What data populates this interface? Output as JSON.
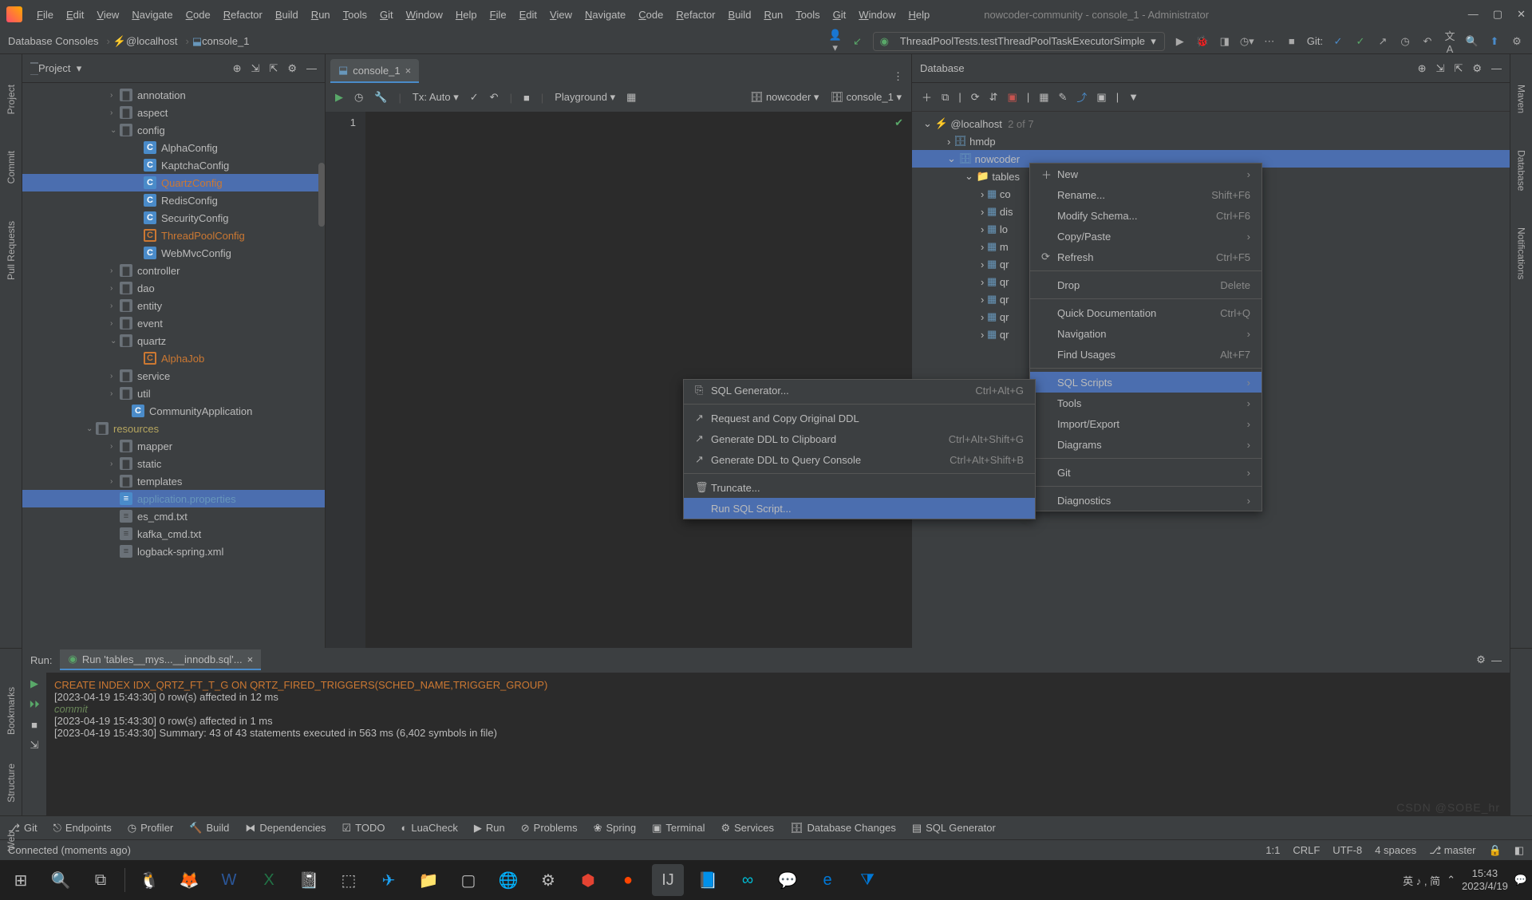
{
  "menubar": {
    "items": [
      "File",
      "Edit",
      "View",
      "Navigate",
      "Code",
      "Refactor",
      "Build",
      "Run",
      "Tools",
      "Git",
      "Window",
      "Help"
    ],
    "title": "nowcoder-community - console_1 - Administrator"
  },
  "breadcrumb": {
    "a": "Database Consoles",
    "b": "@localhost",
    "c": "console_1"
  },
  "runcfg": "ThreadPoolTests.testThreadPoolTaskExecutorSimple",
  "git_label": "Git:",
  "leftbar": [
    "Project",
    "Commit",
    "Pull Requests",
    "Bookmarks",
    "Structure",
    "Web"
  ],
  "rightbar": [
    "Maven",
    "Database",
    "Notifications"
  ],
  "project": {
    "title": "Project",
    "rows": [
      {
        "pad": 110,
        "chev": "›",
        "ic": "folder",
        "t": "annotation"
      },
      {
        "pad": 110,
        "chev": "›",
        "ic": "folder",
        "t": "aspect"
      },
      {
        "pad": 110,
        "chev": "⌄",
        "ic": "folder",
        "t": "config"
      },
      {
        "pad": 140,
        "chev": "",
        "ic": "class",
        "t": "AlphaConfig"
      },
      {
        "pad": 140,
        "chev": "",
        "ic": "class",
        "t": "KaptchaConfig"
      },
      {
        "pad": 140,
        "chev": "",
        "ic": "class",
        "t": "QuartzConfig",
        "cls": "orange",
        "sel": true
      },
      {
        "pad": 140,
        "chev": "",
        "ic": "class",
        "t": "RedisConfig"
      },
      {
        "pad": 140,
        "chev": "",
        "ic": "class",
        "t": "SecurityConfig"
      },
      {
        "pad": 140,
        "chev": "",
        "ic": "classO",
        "t": "ThreadPoolConfig",
        "cls": "orange"
      },
      {
        "pad": 140,
        "chev": "",
        "ic": "class",
        "t": "WebMvcConfig"
      },
      {
        "pad": 110,
        "chev": "›",
        "ic": "folder",
        "t": "controller"
      },
      {
        "pad": 110,
        "chev": "›",
        "ic": "folder",
        "t": "dao"
      },
      {
        "pad": 110,
        "chev": "›",
        "ic": "folder",
        "t": "entity"
      },
      {
        "pad": 110,
        "chev": "›",
        "ic": "folder",
        "t": "event"
      },
      {
        "pad": 110,
        "chev": "⌄",
        "ic": "folder",
        "t": "quartz"
      },
      {
        "pad": 140,
        "chev": "",
        "ic": "classO",
        "t": "AlphaJob",
        "cls": "orange"
      },
      {
        "pad": 110,
        "chev": "›",
        "ic": "folder",
        "t": "service"
      },
      {
        "pad": 110,
        "chev": "›",
        "ic": "folder",
        "t": "util"
      },
      {
        "pad": 125,
        "chev": "",
        "ic": "class",
        "t": "CommunityApplication"
      },
      {
        "pad": 80,
        "chev": "⌄",
        "ic": "resfolder",
        "t": "resources",
        "cls": "resfolder"
      },
      {
        "pad": 110,
        "chev": "›",
        "ic": "folder",
        "t": "mapper"
      },
      {
        "pad": 110,
        "chev": "›",
        "ic": "folder",
        "t": "static"
      },
      {
        "pad": 110,
        "chev": "›",
        "ic": "folder",
        "t": "templates"
      },
      {
        "pad": 110,
        "chev": "",
        "ic": "prop",
        "t": "application.properties",
        "cls": "blue",
        "sel": true
      },
      {
        "pad": 110,
        "chev": "",
        "ic": "file",
        "t": "es_cmd.txt"
      },
      {
        "pad": 110,
        "chev": "",
        "ic": "file",
        "t": "kafka_cmd.txt"
      },
      {
        "pad": 110,
        "chev": "",
        "ic": "file",
        "t": "logback-spring.xml"
      }
    ]
  },
  "editor": {
    "tab": "console_1",
    "tb": {
      "tx": "Tx: Auto",
      "pg": "Playground",
      "sc1": "nowcoder",
      "sc2": "console_1"
    },
    "line": "1"
  },
  "database": {
    "title": "Database",
    "host": "@localhost",
    "hostinfo": "2 of 7",
    "tree": [
      {
        "pad": 30,
        "chev": "›",
        "ic": "db",
        "t": "hmdp"
      },
      {
        "pad": 30,
        "chev": "⌄",
        "ic": "db",
        "t": "nowcoder",
        "sel": true
      },
      {
        "pad": 52,
        "chev": "⌄",
        "ic": "folder",
        "t": "tables"
      },
      {
        "pad": 72,
        "chev": "›",
        "ic": "tbl",
        "t": "co"
      },
      {
        "pad": 72,
        "chev": "›",
        "ic": "tbl",
        "t": "dis"
      },
      {
        "pad": 72,
        "chev": "›",
        "ic": "tbl",
        "t": "lo"
      },
      {
        "pad": 72,
        "chev": "›",
        "ic": "tbl",
        "t": "m"
      },
      {
        "pad": 72,
        "chev": "›",
        "ic": "tbl",
        "t": "qr"
      },
      {
        "pad": 72,
        "chev": "›",
        "ic": "tbl",
        "t": "qr"
      },
      {
        "pad": 72,
        "chev": "›",
        "ic": "tbl",
        "t": "qr"
      },
      {
        "pad": 72,
        "chev": "›",
        "ic": "tbl",
        "t": "qr"
      },
      {
        "pad": 72,
        "chev": "›",
        "ic": "tbl",
        "t": "qr"
      }
    ]
  },
  "ctx1": [
    {
      "ic": "＋",
      "t": "New",
      "sub": "›"
    },
    {
      "t": "Rename...",
      "sc": "Shift+F6",
      "dis": true
    },
    {
      "t": "Modify Schema...",
      "sc": "Ctrl+F6"
    },
    {
      "t": "Copy/Paste",
      "sub": "›"
    },
    {
      "ic": "⟳",
      "t": "Refresh",
      "sc": "Ctrl+F5"
    },
    {
      "sep": true
    },
    {
      "t": "Drop",
      "sc": "Delete"
    },
    {
      "sep": true
    },
    {
      "t": "Quick Documentation",
      "sc": "Ctrl+Q"
    },
    {
      "t": "Navigation",
      "sub": "›"
    },
    {
      "t": "Find Usages",
      "sc": "Alt+F7"
    },
    {
      "sep": true
    },
    {
      "t": "SQL Scripts",
      "sub": "›",
      "hl": true
    },
    {
      "t": "Tools",
      "sub": "›"
    },
    {
      "t": "Import/Export",
      "sub": "›"
    },
    {
      "t": "Diagrams",
      "sub": "›"
    },
    {
      "sep": true
    },
    {
      "t": "Git",
      "sub": "›"
    },
    {
      "sep": true
    },
    {
      "t": "Diagnostics",
      "sub": "›"
    }
  ],
  "ctx2": [
    {
      "ic": "⎘",
      "t": "SQL Generator...",
      "sc": "Ctrl+Alt+G"
    },
    {
      "sep": true
    },
    {
      "ic": "↗",
      "t": "Request and Copy Original DDL"
    },
    {
      "ic": "↗",
      "t": "Generate DDL to Clipboard",
      "sc": "Ctrl+Alt+Shift+G"
    },
    {
      "ic": "↗",
      "t": "Generate DDL to Query Console",
      "sc": "Ctrl+Alt+Shift+B"
    },
    {
      "sep": true
    },
    {
      "ic": "🗑",
      "t": "Truncate..."
    },
    {
      "t": "Run SQL Script...",
      "hl": true
    }
  ],
  "run": {
    "label": "Run:",
    "tab": "Run 'tables__mys...__innodb.sql'...",
    "lines": [
      {
        "cls": "org",
        "t": "CREATE INDEX IDX_QRTZ_FT_T_G ON QRTZ_FIRED_TRIGGERS(SCHED_NAME,TRIGGER_GROUP)"
      },
      {
        "cls": "",
        "t": "[2023-04-19 15:43:30] 0 row(s) affected in 12 ms"
      },
      {
        "cls": "grn",
        "t": "commit"
      },
      {
        "cls": "",
        "t": "[2023-04-19 15:43:30] 0 row(s) affected in 1 ms"
      },
      {
        "cls": "",
        "t": "[2023-04-19 15:43:30] Summary: 43 of 43 statements executed in 563 ms (6,402 symbols in file)"
      }
    ]
  },
  "bottombar": [
    "Git",
    "Endpoints",
    "Profiler",
    "Build",
    "Dependencies",
    "TODO",
    "LuaCheck",
    "Run",
    "Problems",
    "Spring",
    "Terminal",
    "Services",
    "Database Changes",
    "SQL Generator"
  ],
  "status": {
    "msg": "Connected (moments ago)",
    "pos": "1:1",
    "eol": "CRLF",
    "enc": "UTF-8",
    "indent": "4 spaces",
    "branch": "master"
  },
  "tray": {
    "ime": "英 ♪ , 简",
    "time": "15:43",
    "date": "2023/4/19"
  },
  "watermark": "CSDN @SOBE_hr"
}
